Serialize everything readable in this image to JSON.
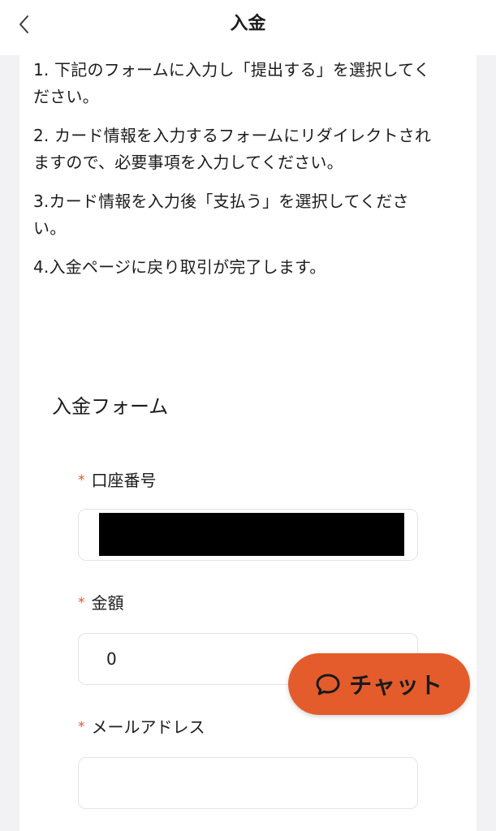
{
  "header": {
    "title": "入金",
    "back_icon": "chevron-left-icon"
  },
  "instructions": [
    "1. 下記のフォームに入力し「提出する」を選択してください。",
    "2. カード情報を入力するフォームにリダイレクトされますので、必要事項を入力してください。",
    "3.カード情報を入力後「支払う」を選択してください。",
    "4.入金ページに戻り取引が完了します。"
  ],
  "form": {
    "title": "入金フォーム",
    "required_mark": "*",
    "account_number": {
      "label": "口座番号",
      "value": "",
      "redacted": true
    },
    "amount": {
      "label": "金額",
      "value": "0"
    },
    "email": {
      "label": "メールアドレス",
      "value": ""
    }
  },
  "chat_button": {
    "label": "チャット",
    "icon": "chat-bubble-icon",
    "color": "#e45c2c"
  },
  "colors": {
    "accent": "#e45c2c",
    "required": "#e5532a",
    "background": "#f2f2f4"
  }
}
